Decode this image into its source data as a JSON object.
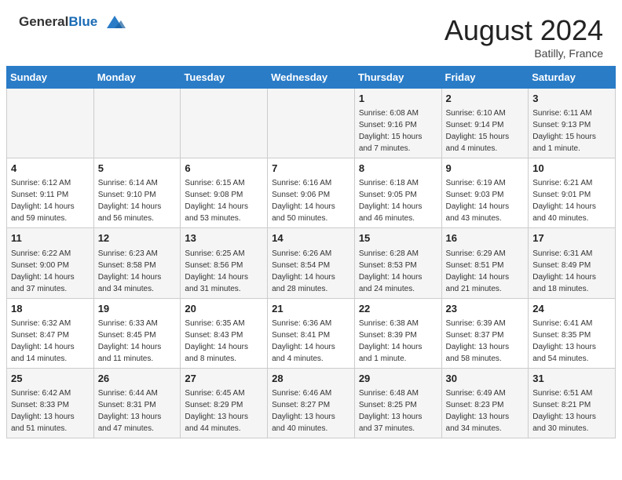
{
  "header": {
    "logo_general": "General",
    "logo_blue": "Blue",
    "month_year": "August 2024",
    "location": "Batilly, France"
  },
  "days_of_week": [
    "Sunday",
    "Monday",
    "Tuesday",
    "Wednesday",
    "Thursday",
    "Friday",
    "Saturday"
  ],
  "weeks": [
    [
      {
        "day": "",
        "info": ""
      },
      {
        "day": "",
        "info": ""
      },
      {
        "day": "",
        "info": ""
      },
      {
        "day": "",
        "info": ""
      },
      {
        "day": "1",
        "info": "Sunrise: 6:08 AM\nSunset: 9:16 PM\nDaylight: 15 hours\nand 7 minutes."
      },
      {
        "day": "2",
        "info": "Sunrise: 6:10 AM\nSunset: 9:14 PM\nDaylight: 15 hours\nand 4 minutes."
      },
      {
        "day": "3",
        "info": "Sunrise: 6:11 AM\nSunset: 9:13 PM\nDaylight: 15 hours\nand 1 minute."
      }
    ],
    [
      {
        "day": "4",
        "info": "Sunrise: 6:12 AM\nSunset: 9:11 PM\nDaylight: 14 hours\nand 59 minutes."
      },
      {
        "day": "5",
        "info": "Sunrise: 6:14 AM\nSunset: 9:10 PM\nDaylight: 14 hours\nand 56 minutes."
      },
      {
        "day": "6",
        "info": "Sunrise: 6:15 AM\nSunset: 9:08 PM\nDaylight: 14 hours\nand 53 minutes."
      },
      {
        "day": "7",
        "info": "Sunrise: 6:16 AM\nSunset: 9:06 PM\nDaylight: 14 hours\nand 50 minutes."
      },
      {
        "day": "8",
        "info": "Sunrise: 6:18 AM\nSunset: 9:05 PM\nDaylight: 14 hours\nand 46 minutes."
      },
      {
        "day": "9",
        "info": "Sunrise: 6:19 AM\nSunset: 9:03 PM\nDaylight: 14 hours\nand 43 minutes."
      },
      {
        "day": "10",
        "info": "Sunrise: 6:21 AM\nSunset: 9:01 PM\nDaylight: 14 hours\nand 40 minutes."
      }
    ],
    [
      {
        "day": "11",
        "info": "Sunrise: 6:22 AM\nSunset: 9:00 PM\nDaylight: 14 hours\nand 37 minutes."
      },
      {
        "day": "12",
        "info": "Sunrise: 6:23 AM\nSunset: 8:58 PM\nDaylight: 14 hours\nand 34 minutes."
      },
      {
        "day": "13",
        "info": "Sunrise: 6:25 AM\nSunset: 8:56 PM\nDaylight: 14 hours\nand 31 minutes."
      },
      {
        "day": "14",
        "info": "Sunrise: 6:26 AM\nSunset: 8:54 PM\nDaylight: 14 hours\nand 28 minutes."
      },
      {
        "day": "15",
        "info": "Sunrise: 6:28 AM\nSunset: 8:53 PM\nDaylight: 14 hours\nand 24 minutes."
      },
      {
        "day": "16",
        "info": "Sunrise: 6:29 AM\nSunset: 8:51 PM\nDaylight: 14 hours\nand 21 minutes."
      },
      {
        "day": "17",
        "info": "Sunrise: 6:31 AM\nSunset: 8:49 PM\nDaylight: 14 hours\nand 18 minutes."
      }
    ],
    [
      {
        "day": "18",
        "info": "Sunrise: 6:32 AM\nSunset: 8:47 PM\nDaylight: 14 hours\nand 14 minutes."
      },
      {
        "day": "19",
        "info": "Sunrise: 6:33 AM\nSunset: 8:45 PM\nDaylight: 14 hours\nand 11 minutes."
      },
      {
        "day": "20",
        "info": "Sunrise: 6:35 AM\nSunset: 8:43 PM\nDaylight: 14 hours\nand 8 minutes."
      },
      {
        "day": "21",
        "info": "Sunrise: 6:36 AM\nSunset: 8:41 PM\nDaylight: 14 hours\nand 4 minutes."
      },
      {
        "day": "22",
        "info": "Sunrise: 6:38 AM\nSunset: 8:39 PM\nDaylight: 14 hours\nand 1 minute."
      },
      {
        "day": "23",
        "info": "Sunrise: 6:39 AM\nSunset: 8:37 PM\nDaylight: 13 hours\nand 58 minutes."
      },
      {
        "day": "24",
        "info": "Sunrise: 6:41 AM\nSunset: 8:35 PM\nDaylight: 13 hours\nand 54 minutes."
      }
    ],
    [
      {
        "day": "25",
        "info": "Sunrise: 6:42 AM\nSunset: 8:33 PM\nDaylight: 13 hours\nand 51 minutes."
      },
      {
        "day": "26",
        "info": "Sunrise: 6:44 AM\nSunset: 8:31 PM\nDaylight: 13 hours\nand 47 minutes."
      },
      {
        "day": "27",
        "info": "Sunrise: 6:45 AM\nSunset: 8:29 PM\nDaylight: 13 hours\nand 44 minutes."
      },
      {
        "day": "28",
        "info": "Sunrise: 6:46 AM\nSunset: 8:27 PM\nDaylight: 13 hours\nand 40 minutes."
      },
      {
        "day": "29",
        "info": "Sunrise: 6:48 AM\nSunset: 8:25 PM\nDaylight: 13 hours\nand 37 minutes."
      },
      {
        "day": "30",
        "info": "Sunrise: 6:49 AM\nSunset: 8:23 PM\nDaylight: 13 hours\nand 34 minutes."
      },
      {
        "day": "31",
        "info": "Sunrise: 6:51 AM\nSunset: 8:21 PM\nDaylight: 13 hours\nand 30 minutes."
      }
    ]
  ]
}
